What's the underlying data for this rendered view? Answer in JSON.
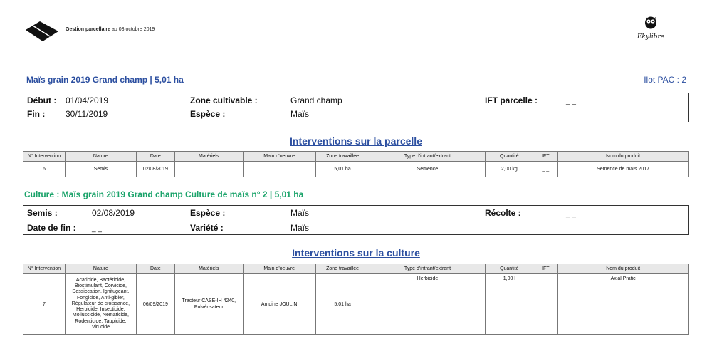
{
  "header": {
    "title_bold": "Gestion parcellaire",
    "title_rest": " au 03 octobre 2019",
    "brand": "Ekylibre"
  },
  "parcel": {
    "title": "Maïs grain 2019 Grand champ | 5,01 ha",
    "ilot": "Ilot PAC : 2",
    "debut_label": "Début :",
    "debut": "01/04/2019",
    "fin_label": "Fin :",
    "fin": "30/11/2019",
    "zone_label": "Zone cultivable :",
    "zone": "Grand champ",
    "espece_label": "Espèce :",
    "espece": "Maïs",
    "ift_label": "IFT parcelle :",
    "ift": "_ _"
  },
  "interventions_parcelle": {
    "title": "Interventions sur la parcelle",
    "headers": [
      "N° Intervention",
      "Nature",
      "Date",
      "Matériels",
      "Main d'oeuvre",
      "Zone travaillée",
      "Type d'intrant/extrant",
      "Quantité",
      "IFT",
      "Nom du produit"
    ],
    "rows": [
      [
        "6",
        "Semis",
        "02/08/2019",
        "",
        "",
        "5,01 ha",
        "Semence",
        "2,00 kg",
        "_ _",
        "Semence de maïs 2017"
      ]
    ]
  },
  "culture": {
    "title": "Culture : Maïs grain 2019 Grand champ Culture de maïs n° 2 | 5,01 ha",
    "semis_label": "Semis :",
    "semis": "02/08/2019",
    "date_fin_label": "Date de fin :",
    "date_fin": "_ _",
    "espece_label": "Espèce :",
    "espece": "Maïs",
    "variete_label": "Variété :",
    "variete": "Maïs",
    "recolte_label": "Récolte :",
    "recolte": "_ _"
  },
  "interventions_culture": {
    "title": "Interventions sur la culture",
    "headers": [
      "N° Intervention",
      "Nature",
      "Date",
      "Matériels",
      "Main d'oeuvre",
      "Zone travaillée",
      "Type d'intrant/extrant",
      "Quantité",
      "IFT",
      "Nom du produit"
    ],
    "row": {
      "num": "7",
      "nature_lines": [
        "Acaricide, Bactéricide,",
        "Biostimulant, Corvicide,",
        "Dessiccation, Ignifugeant,",
        "Fongicide, Anti-gibier,",
        "Régulateur de croissance,",
        "Herbicide, Insecticide,",
        "Molluscicide, Nématicide,",
        "Rodenticide, Taupicide,",
        "Virucide"
      ],
      "date": "06/09/2019",
      "materiels_lines": [
        "Tracteur CASE-IH 4240,",
        "Pulvérisateur"
      ],
      "main_oeuvre": "Antoine JOULIN",
      "zone": "5,01 ha",
      "type": "Herbicide",
      "quantite": "1,00 l",
      "ift": "_ _",
      "produit": "Axial Pratic"
    }
  }
}
